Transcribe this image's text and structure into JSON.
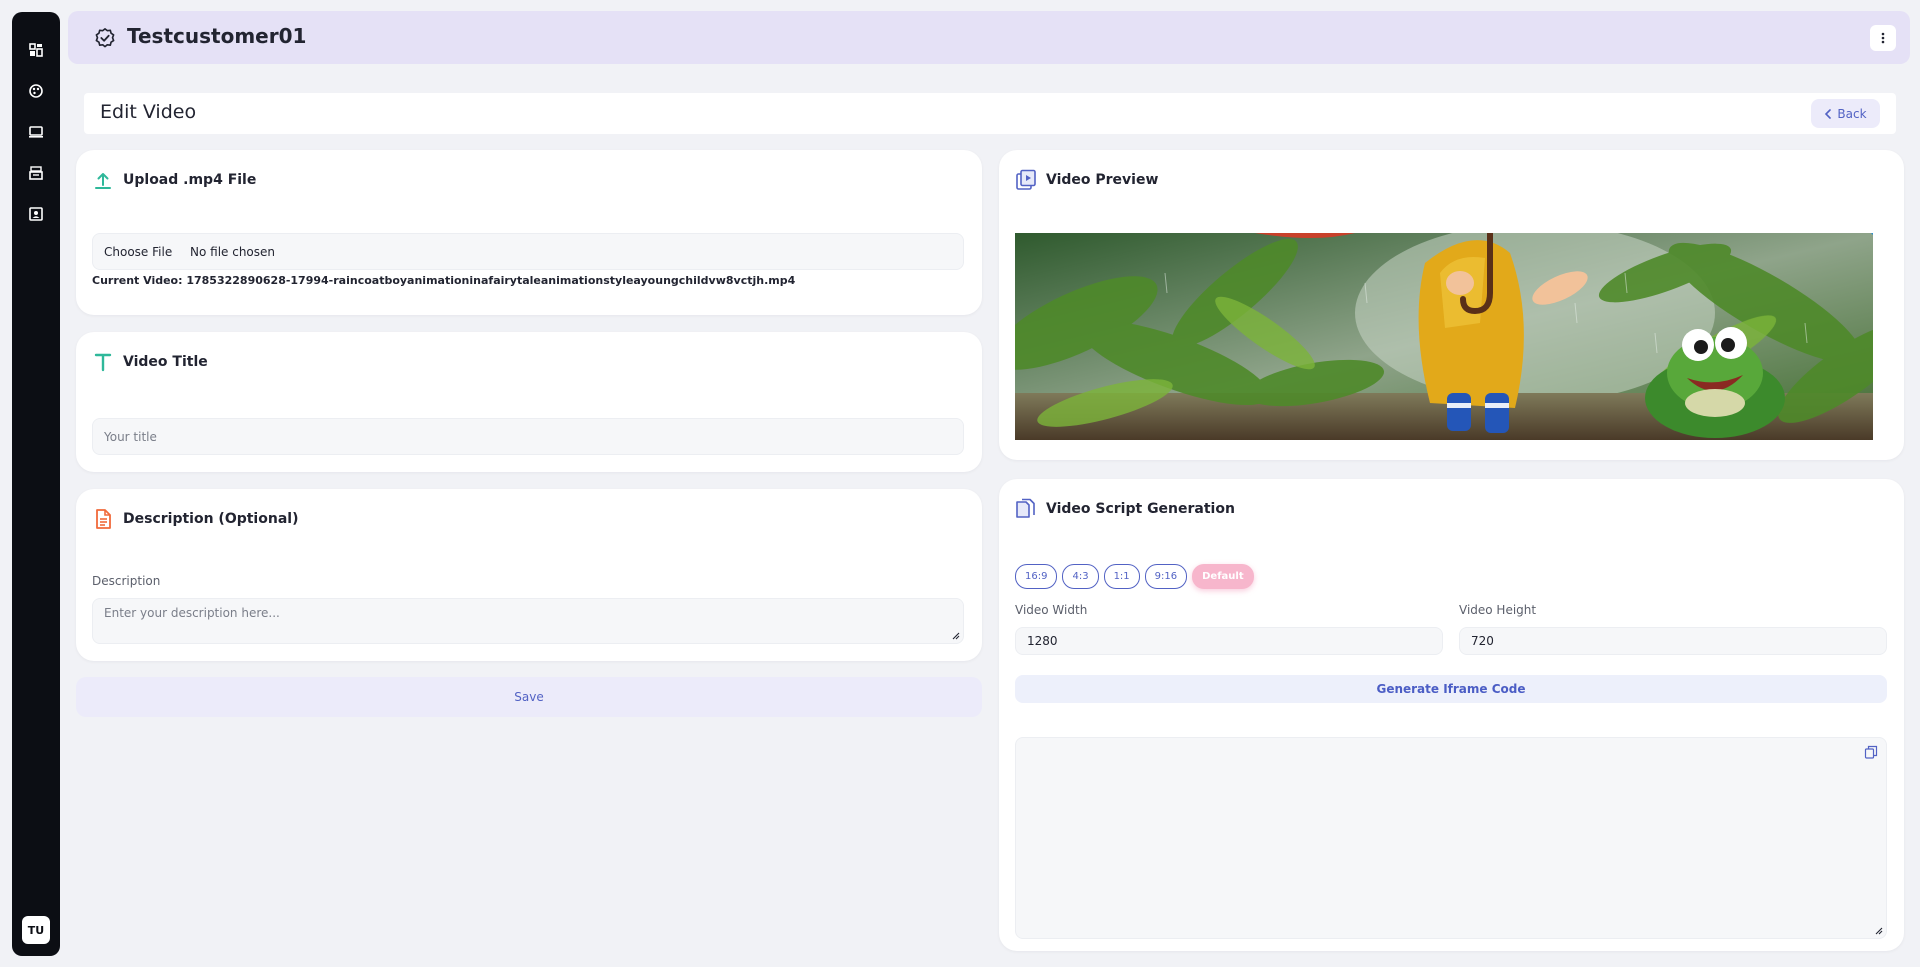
{
  "header": {
    "brand_name": "Testcustomer01"
  },
  "sidebar": {
    "items": [
      {
        "icon": "dashboard-icon"
      },
      {
        "icon": "palette-icon"
      },
      {
        "icon": "monitor-icon"
      },
      {
        "icon": "inbox-icon"
      },
      {
        "icon": "contact-card-icon"
      }
    ],
    "avatar_initials": "TU"
  },
  "page": {
    "title": "Edit Video",
    "back_label": "Back"
  },
  "upload": {
    "title": "Upload .mp4 File",
    "choose_label": "Choose File",
    "file_status": "No file chosen",
    "current_video": "Current Video: 1785322890628-17994-raincoatboyanimationinafairytaleanimationstyleayoungchildvw8vctjh.mp4"
  },
  "video_title": {
    "title": "Video Title",
    "placeholder": "Your title"
  },
  "description": {
    "title": "Description (Optional)",
    "label": "Description",
    "placeholder": "Enter your description here..."
  },
  "save_label": "Save",
  "preview": {
    "title": "Video Preview"
  },
  "script_gen": {
    "title": "Video Script Generation",
    "ratios": [
      "16:9",
      "4:3",
      "1:1",
      "9:16",
      "Default"
    ],
    "active_ratio": "Default",
    "width_label": "Video Width",
    "width_value": "1280",
    "height_label": "Video Height",
    "height_value": "720",
    "generate_label": "Generate Iframe Code"
  },
  "colors": {
    "accent": "#5262c4",
    "topbar_bg": "#e5e1f6",
    "upload_icon": "#2fb89a",
    "description_icon": "#f06a3b",
    "active_ratio": "#f7b6cc"
  }
}
